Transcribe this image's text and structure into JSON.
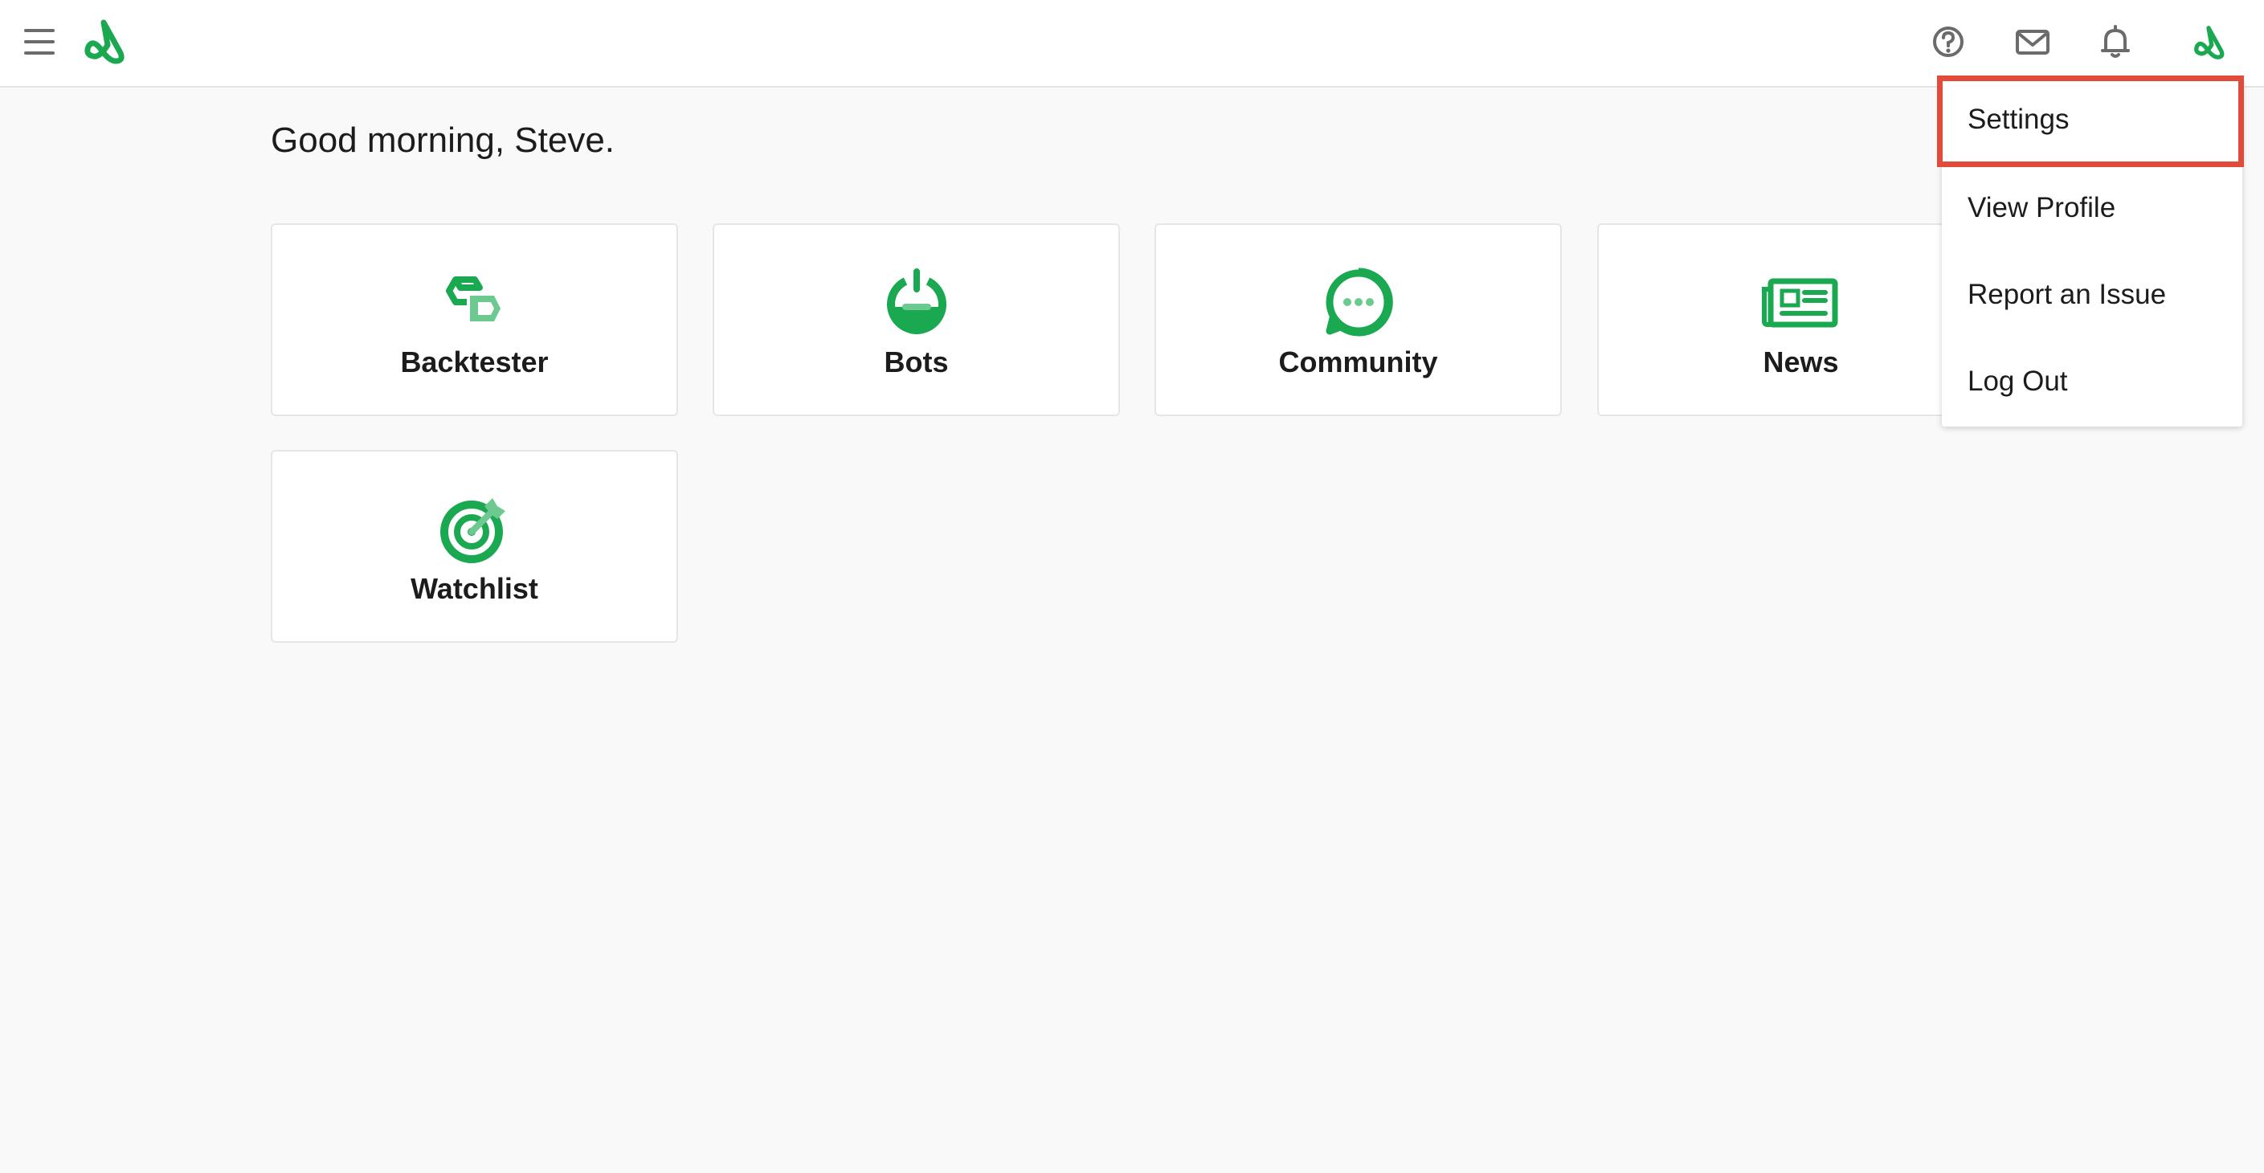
{
  "header": {
    "menu_icon": "hamburger-menu-icon",
    "logo_icon": "brand-logo-icon",
    "actions": [
      {
        "name": "help",
        "icon": "question-circle-icon"
      },
      {
        "name": "messages",
        "icon": "envelope-icon"
      },
      {
        "name": "notifications",
        "icon": "bell-icon"
      },
      {
        "name": "account",
        "icon": "brand-logo-icon"
      }
    ]
  },
  "main": {
    "greeting": "Good morning, Steve.",
    "tiles": [
      {
        "label": "Backtester",
        "icon": "backtester-icon"
      },
      {
        "label": "Bots",
        "icon": "bots-power-icon"
      },
      {
        "label": "Community",
        "icon": "chat-bubble-icon"
      },
      {
        "label": "News",
        "icon": "newspaper-icon"
      },
      {
        "label": "Watchlist",
        "icon": "target-icon"
      }
    ]
  },
  "account_menu": {
    "items": [
      {
        "label": "Settings",
        "highlighted": true
      },
      {
        "label": "View Profile"
      },
      {
        "label": "Report an Issue"
      },
      {
        "label": "Log Out"
      }
    ]
  },
  "colors": {
    "brand_green": "#1aa851",
    "brand_green_light": "#6cc98f",
    "highlight_red": "#e04b3a",
    "icon_gray": "#6b6b6b",
    "background": "#f9f9f9"
  }
}
